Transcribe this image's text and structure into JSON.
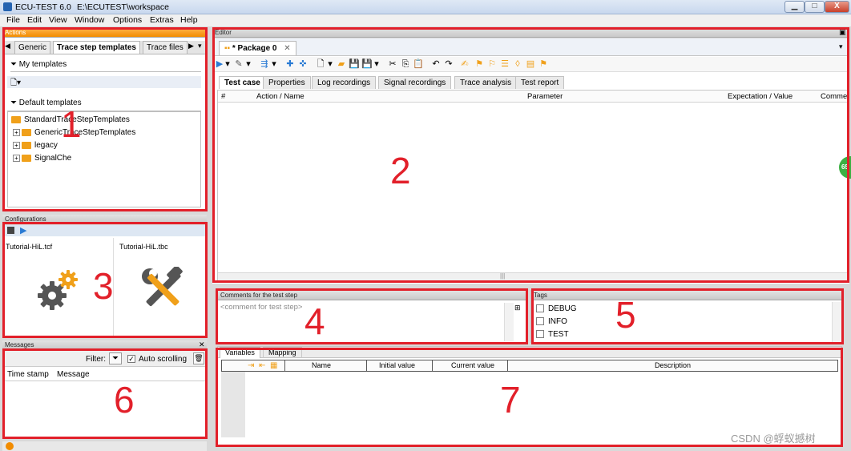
{
  "window": {
    "app_title": "ECU-TEST 6.0",
    "workspace_path": "E:\\ECUTEST\\workspace",
    "minimize_label": "▁",
    "maximize_label": "□",
    "close_label": "X"
  },
  "menu": [
    "File",
    "Edit",
    "View",
    "Window",
    "Options",
    "Extras",
    "Help"
  ],
  "actions": {
    "header": "Actions",
    "tabs": [
      "Generic",
      "Trace step templates",
      "Trace files"
    ],
    "my_templates": "My templates",
    "default_templates": "Default templates",
    "tree": [
      {
        "label": "StandardTraceStepTemplates",
        "indent": 0,
        "expandable": false
      },
      {
        "label": "GenericTraceStepTemplates",
        "indent": 1,
        "expandable": true
      },
      {
        "label": "legacy",
        "indent": 1,
        "expandable": true
      },
      {
        "label": "SignalChe",
        "indent": 1,
        "expandable": true
      }
    ]
  },
  "configurations": {
    "header": "Configurations",
    "items": [
      {
        "label": "Tutorial-HiL.tcf",
        "icon": "gears-icon"
      },
      {
        "label": "Tutorial-HiL.tbc",
        "icon": "tools-icon"
      }
    ]
  },
  "messages": {
    "header": "Messages",
    "filter_label": "Filter:",
    "auto_scrolling_label": "Auto scrolling",
    "auto_scrolling": true,
    "columns": [
      "Time stamp",
      "Message"
    ]
  },
  "editor": {
    "header": "Editor",
    "doc_tab": "* Package 0",
    "subtabs": [
      "Test case",
      "Properties",
      "Log recordings",
      "Signal recordings",
      "Trace analysis",
      "Test report"
    ],
    "selected_subtab": "Test case",
    "columns": [
      "#",
      "Action / Name",
      "Parameter",
      "Expectation / Value",
      "Comme"
    ]
  },
  "comments": {
    "header": "Comments for the test step",
    "placeholder": "<comment for test step>"
  },
  "tags": {
    "header": "Tags",
    "items": [
      "DEBUG",
      "INFO",
      "TEST"
    ]
  },
  "variables": {
    "tabs": [
      "Variables",
      "Mapping"
    ],
    "columns": [
      "Name",
      "Initial value",
      "Current value",
      "Description"
    ]
  },
  "annotations": [
    "1",
    "2",
    "3",
    "4",
    "5",
    "6",
    "7"
  ],
  "watermark": "CSDN @蜉蚁撼树",
  "badge_text": "65",
  "colors": {
    "accent_orange": "#f28c00",
    "annotation_red": "#e2202a",
    "icon_orange": "#f0a01a",
    "icon_dark": "#555555",
    "badge_green": "#3cb043"
  }
}
